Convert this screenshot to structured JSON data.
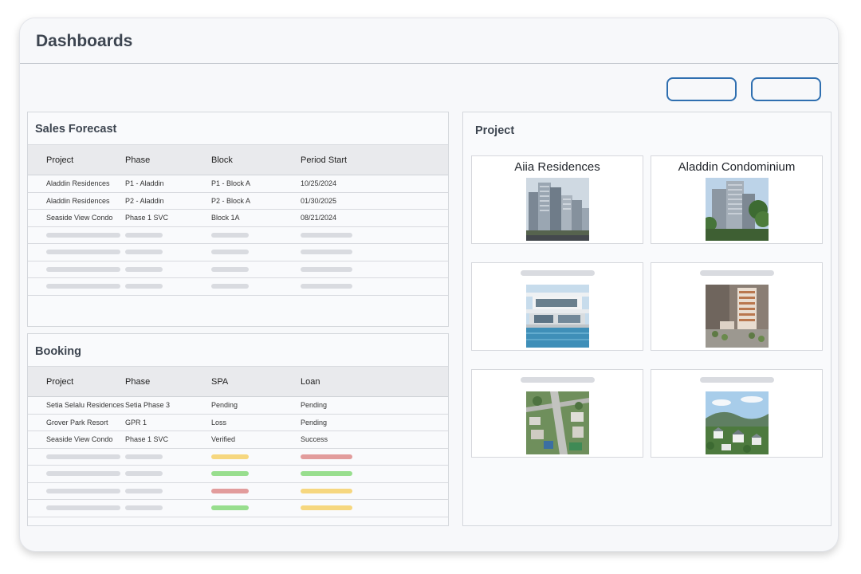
{
  "header": {
    "title": "Dashboards"
  },
  "sales_forecast": {
    "title": "Sales Forecast",
    "columns": [
      "Project",
      "Phase",
      "Block",
      "Period Start"
    ],
    "rows": [
      [
        "Aladdin Residences",
        "P1 - Aladdin",
        "P1 - Block A",
        "10/25/2024"
      ],
      [
        "Aladdin Residences",
        "P2 - Aladdin",
        "P2 - Block A",
        "01/30/2025"
      ],
      [
        "Seaside View Condo",
        "Phase 1 SVC",
        "Block 1A",
        "08/21/2024"
      ]
    ]
  },
  "booking": {
    "title": "Booking",
    "columns": [
      "Project",
      "Phase",
      "SPA",
      "Loan"
    ],
    "rows": [
      [
        "Setia Selalu Residences",
        "Setia Phase 3",
        "Pending",
        "Pending"
      ],
      [
        "Grover Park Resort",
        "GPR 1",
        "Loss",
        "Pending"
      ],
      [
        "Seaside View Condo",
        "Phase 1 SVC",
        "Verified",
        "Success"
      ]
    ],
    "placeholder_status_colors": [
      [
        "#f6d77f",
        "#e29c9c"
      ],
      [
        "#98de8e",
        "#98de8e"
      ],
      [
        "#e29c9c",
        "#f6d77f"
      ],
      [
        "#98de8e",
        "#f6d77f"
      ]
    ]
  },
  "project": {
    "title": "Project",
    "cards": [
      {
        "title": "Aiia Residences",
        "image": "high-rise-towers-photo"
      },
      {
        "title": "Aladdin Condominium",
        "image": "condominium-tower-photo"
      },
      {
        "title": "",
        "image": "villa-pool-photo"
      },
      {
        "title": "",
        "image": "building-model-photo"
      },
      {
        "title": "",
        "image": "aerial-township-photo"
      },
      {
        "title": "",
        "image": "hillside-houses-photo"
      }
    ]
  },
  "colors": {
    "accent": "#2f6fb0",
    "status_green": "#98de8e",
    "status_yellow": "#f6d77f",
    "status_red": "#e29c9c"
  }
}
